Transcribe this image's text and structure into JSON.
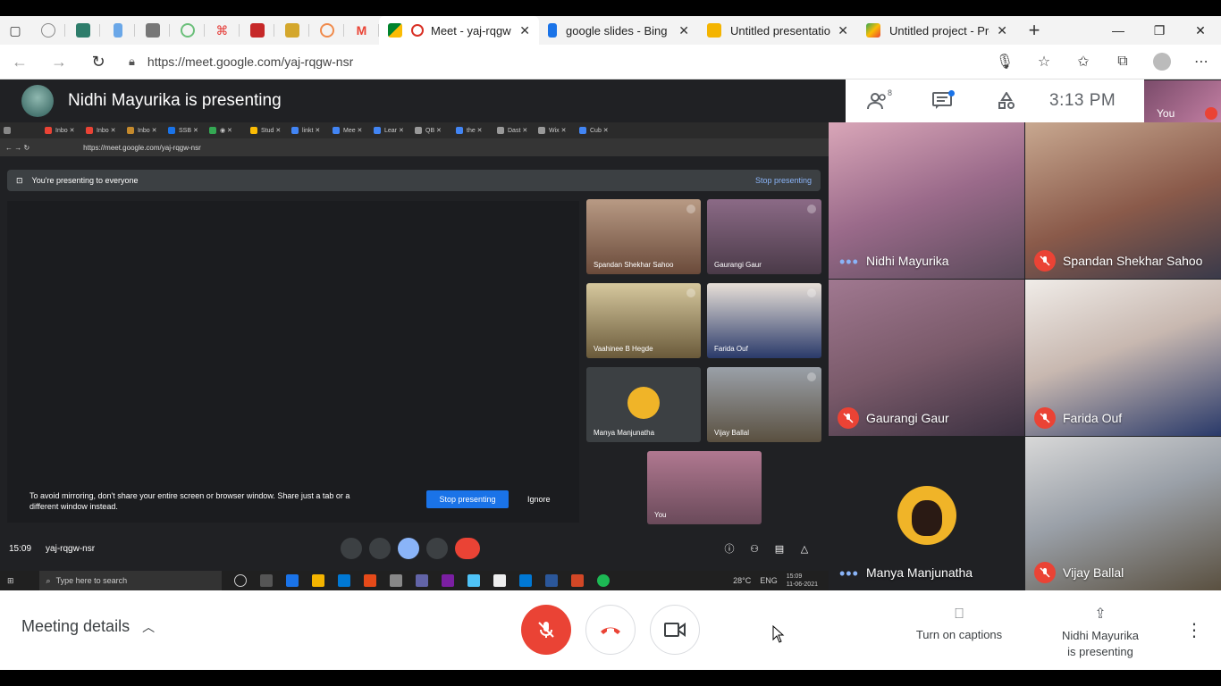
{
  "browser": {
    "tabs": [
      {
        "label": "Meet - yaj-rqgw",
        "active": true,
        "color": "#d93025"
      },
      {
        "label": "google slides - Bing",
        "active": false,
        "color": "#1a73e8"
      },
      {
        "label": "Untitled presentation",
        "active": false,
        "color": "#f4b400"
      },
      {
        "label": "Untitled project - Pro",
        "active": false,
        "color": "#34a853"
      }
    ],
    "pinned_icons": [
      "sidebar-icon",
      "pocket-icon",
      "tool-icon",
      "bing-icon",
      "chart-icon",
      "loader-icon",
      "acrobat-icon",
      "pdf-icon",
      "document-icon",
      "firefox-icon",
      "gmail-icon",
      "meet-icon"
    ],
    "url": "https://meet.google.com/yaj-rqgw-nsr"
  },
  "meet": {
    "presenter_title": "Nidhi Mayurika is presenting",
    "participant_count": "8",
    "clock": "3:13 PM",
    "self_label": "You",
    "participants": [
      {
        "name": "Nidhi Mayurika",
        "muted": false,
        "speaking": true
      },
      {
        "name": "Spandan Shekhar Sahoo",
        "muted": true
      },
      {
        "name": "Gaurangi Gaur",
        "muted": true
      },
      {
        "name": "Farida Ouf",
        "muted": true
      },
      {
        "name": "Manya Manjunatha",
        "muted": false,
        "speaking": true
      },
      {
        "name": "Vijay Ballal",
        "muted": true
      }
    ]
  },
  "shared_screen": {
    "url": "https://meet.google.com/yaj-rqgw-nsr",
    "banner": "You're presenting to everyone",
    "banner_stop": "Stop presenting",
    "tip": "To avoid mirroring, don't share your entire screen or browser window. Share just a tab or a different window instead.",
    "stop_button": "Stop presenting",
    "ignore_button": "Ignore",
    "time": "15:09",
    "code": "yaj-rqgw-nsr",
    "search_placeholder": "Type here to search",
    "temp": "28°C",
    "lang": "ENG",
    "tray_time": "15:09",
    "tray_date": "11-06-2021",
    "tiles": [
      {
        "name": "Spandan Shekhar Sahoo"
      },
      {
        "name": "Gaurangi Gaur"
      },
      {
        "name": "Vaahinee B Hegde"
      },
      {
        "name": "Farida Ouf"
      },
      {
        "name": "Manya Manjunatha"
      },
      {
        "name": "Vijay Ballal"
      },
      {
        "name": "You"
      }
    ]
  },
  "bottom": {
    "meeting_details": "Meeting details",
    "captions": "Turn on captions",
    "presenting_line1": "Nidhi Mayurika",
    "presenting_line2": "is presenting"
  }
}
